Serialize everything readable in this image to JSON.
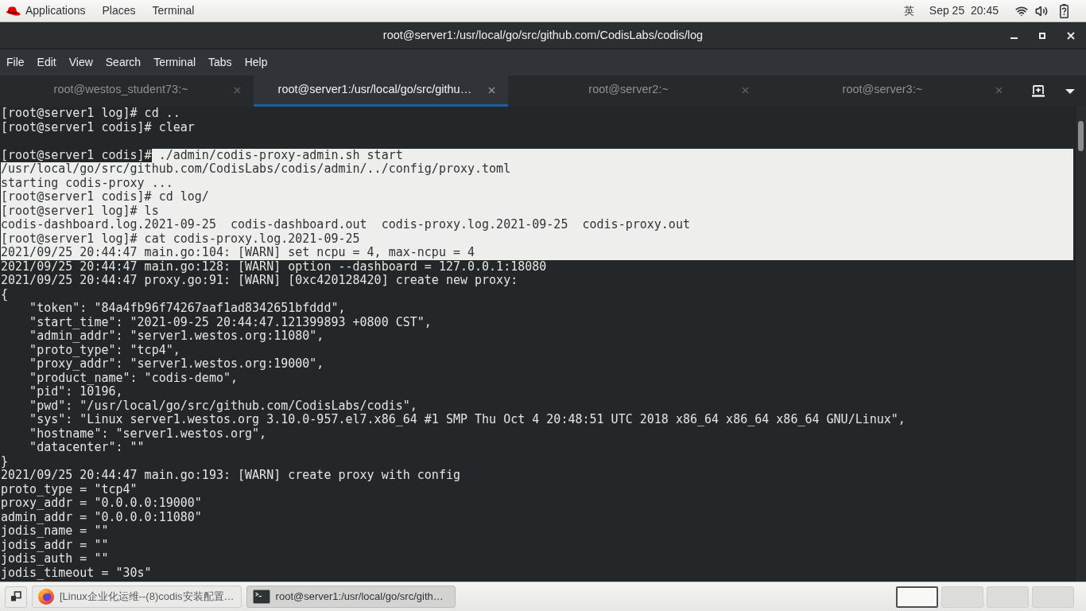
{
  "top_bar": {
    "menus": [
      "Applications",
      "Places",
      "Terminal"
    ],
    "input_method": "英",
    "clock": "Sep 25  20:45"
  },
  "window": {
    "title": "root@server1:/usr/local/go/src/github.com/CodisLabs/codis/log",
    "menu": [
      "File",
      "Edit",
      "View",
      "Search",
      "Terminal",
      "Tabs",
      "Help"
    ]
  },
  "tabs": [
    {
      "label": "root@westos_student73:~",
      "selected": false
    },
    {
      "label": "root@server1:/usr/local/go/src/githu…",
      "selected": true
    },
    {
      "label": "root@server2:~",
      "selected": false
    },
    {
      "label": "root@server3:~",
      "selected": false
    }
  ],
  "terminal": {
    "lines": [
      {
        "kind": "text",
        "parts": [
          {
            "text": "[root@server1 log]# cd ..",
            "selected": false
          }
        ]
      },
      {
        "kind": "text",
        "parts": [
          {
            "text": "[root@server1 codis]# clear",
            "selected": false
          }
        ]
      },
      {
        "kind": "blank"
      },
      {
        "kind": "text",
        "parts": [
          {
            "text": "[root@server1 codis]#",
            "selected": false
          },
          {
            "text": " ./admin/codis-proxy-admin.sh start",
            "selected": true
          }
        ]
      },
      {
        "kind": "text",
        "parts": [
          {
            "text": "/usr/local/go/src/github.com/CodisLabs/codis/admin/../config/proxy.toml",
            "selected": true
          }
        ]
      },
      {
        "kind": "text",
        "parts": [
          {
            "text": "starting codis-proxy ...",
            "selected": true
          }
        ]
      },
      {
        "kind": "text",
        "parts": [
          {
            "text": "[root@server1 codis]# cd log/",
            "selected": true
          }
        ]
      },
      {
        "kind": "text",
        "parts": [
          {
            "text": "[root@server1 log]# ls",
            "selected": true
          }
        ]
      },
      {
        "kind": "text",
        "parts": [
          {
            "text": "codis-dashboard.log.2021-09-25  codis-dashboard.out  codis-proxy.log.2021-09-25  codis-proxy.out",
            "selected": true
          }
        ]
      },
      {
        "kind": "text",
        "parts": [
          {
            "text": "[root@server1 log]# cat codis-proxy.log.2021-09-25",
            "selected": true
          }
        ]
      },
      {
        "kind": "text",
        "parts": [
          {
            "text": "2021/09/25 20:44:47 main.go:104: [WARN] set ncpu = 4, max-ncpu = 4",
            "selected": true
          }
        ]
      },
      {
        "kind": "text",
        "parts": [
          {
            "text": "2021/09/25 20:44:47 main.go:128: [WARN] option --dashboard = 127.0.0.1:18080",
            "selected": false
          }
        ]
      },
      {
        "kind": "text",
        "parts": [
          {
            "text": "2021/09/25 20:44:47 proxy.go:91: [WARN] [0xc420128420] create new proxy:",
            "selected": false
          }
        ]
      },
      {
        "kind": "text",
        "parts": [
          {
            "text": "{",
            "selected": false
          }
        ]
      },
      {
        "kind": "text",
        "parts": [
          {
            "text": "    \"token\": \"84a4fb96f74267aaf1ad8342651bfddd\",",
            "selected": false
          }
        ]
      },
      {
        "kind": "text",
        "parts": [
          {
            "text": "    \"start_time\": \"2021-09-25 20:44:47.121399893 +0800 CST\",",
            "selected": false
          }
        ]
      },
      {
        "kind": "text",
        "parts": [
          {
            "text": "    \"admin_addr\": \"server1.westos.org:11080\",",
            "selected": false
          }
        ]
      },
      {
        "kind": "text",
        "parts": [
          {
            "text": "    \"proto_type\": \"tcp4\",",
            "selected": false
          }
        ]
      },
      {
        "kind": "text",
        "parts": [
          {
            "text": "    \"proxy_addr\": \"server1.westos.org:19000\",",
            "selected": false
          }
        ]
      },
      {
        "kind": "text",
        "parts": [
          {
            "text": "    \"product_name\": \"codis-demo\",",
            "selected": false
          }
        ]
      },
      {
        "kind": "text",
        "parts": [
          {
            "text": "    \"pid\": 10196,",
            "selected": false
          }
        ]
      },
      {
        "kind": "text",
        "parts": [
          {
            "text": "    \"pwd\": \"/usr/local/go/src/github.com/CodisLabs/codis\",",
            "selected": false
          }
        ]
      },
      {
        "kind": "text",
        "parts": [
          {
            "text": "    \"sys\": \"Linux server1.westos.org 3.10.0-957.el7.x86_64 #1 SMP Thu Oct 4 20:48:51 UTC 2018 x86_64 x86_64 x86_64 GNU/Linux\",",
            "selected": false
          }
        ]
      },
      {
        "kind": "text",
        "parts": [
          {
            "text": "    \"hostname\": \"server1.westos.org\",",
            "selected": false
          }
        ]
      },
      {
        "kind": "text",
        "parts": [
          {
            "text": "    \"datacenter\": \"\"",
            "selected": false
          }
        ]
      },
      {
        "kind": "text",
        "parts": [
          {
            "text": "}",
            "selected": false
          }
        ]
      },
      {
        "kind": "text",
        "parts": [
          {
            "text": "2021/09/25 20:44:47 main.go:193: [WARN] create proxy with config",
            "selected": false
          }
        ]
      },
      {
        "kind": "text",
        "parts": [
          {
            "text": "proto_type = \"tcp4\"",
            "selected": false
          }
        ]
      },
      {
        "kind": "text",
        "parts": [
          {
            "text": "proxy_addr = \"0.0.0.0:19000\"",
            "selected": false
          }
        ]
      },
      {
        "kind": "text",
        "parts": [
          {
            "text": "admin_addr = \"0.0.0.0:11080\"",
            "selected": false
          }
        ]
      },
      {
        "kind": "text",
        "parts": [
          {
            "text": "jodis_name = \"\"",
            "selected": false
          }
        ]
      },
      {
        "kind": "text",
        "parts": [
          {
            "text": "jodis_addr = \"\"",
            "selected": false
          }
        ]
      },
      {
        "kind": "text",
        "parts": [
          {
            "text": "jodis_auth = \"\"",
            "selected": false
          }
        ]
      },
      {
        "kind": "text",
        "parts": [
          {
            "text": "jodis_timeout = \"30s\"",
            "selected": false
          }
        ]
      }
    ]
  },
  "taskbar": {
    "windows": [
      {
        "kind": "browser",
        "label": "[Linux企业化运维--(8)codis安装配置…",
        "selected": false
      },
      {
        "kind": "terminal",
        "label": "root@server1:/usr/local/go/src/gith…",
        "selected": true
      }
    ],
    "workspaces": [
      {
        "selected": true
      },
      {
        "selected": false
      },
      {
        "selected": false
      },
      {
        "selected": false
      }
    ]
  }
}
